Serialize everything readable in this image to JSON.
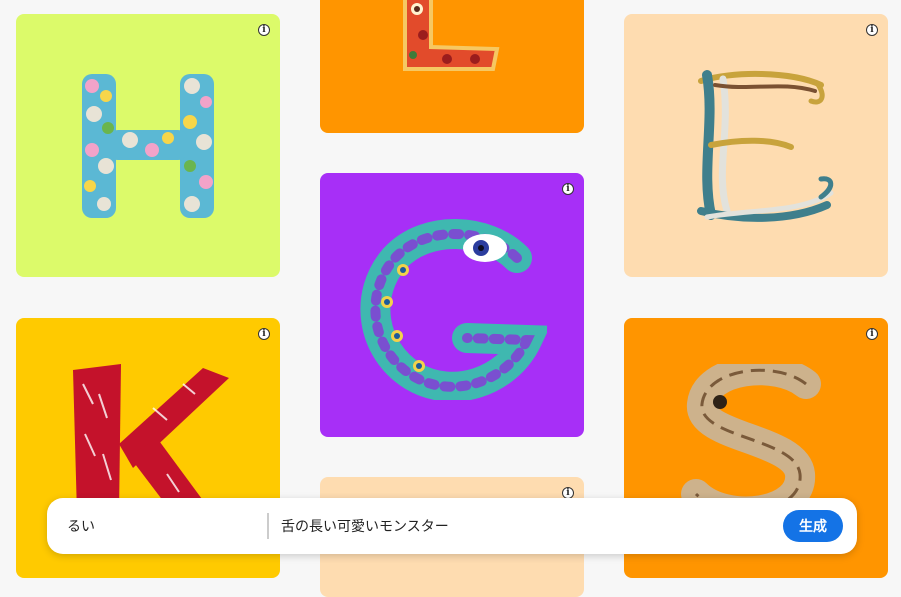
{
  "tiles": [
    {
      "letter": "H",
      "style": "colorful spheres",
      "bg": "#dcfa6a",
      "icon": "info-icon"
    },
    {
      "letter": "L",
      "style": "pizza",
      "bg": "#ff9500",
      "icon": "info-icon"
    },
    {
      "letter": "E",
      "style": "tangled ribbons",
      "bg": "#fedcb0",
      "icon": "info-icon"
    },
    {
      "letter": "G",
      "style": "peacock feathers",
      "bg": "#a72ff7",
      "icon": "info-icon"
    },
    {
      "letter": "K",
      "style": "red fur",
      "bg": "#ffca00",
      "icon": "info-icon"
    },
    {
      "letter": "S",
      "style": "driftwood",
      "bg": "#ff9500",
      "icon": "info-icon"
    },
    {
      "letter": "",
      "style": "partial",
      "bg": "#fedcb0",
      "icon": "info-icon"
    }
  ],
  "prompt": {
    "style_label": "るい",
    "input_value": "舌の長い可愛いモンスター",
    "generate_label": "生成"
  }
}
